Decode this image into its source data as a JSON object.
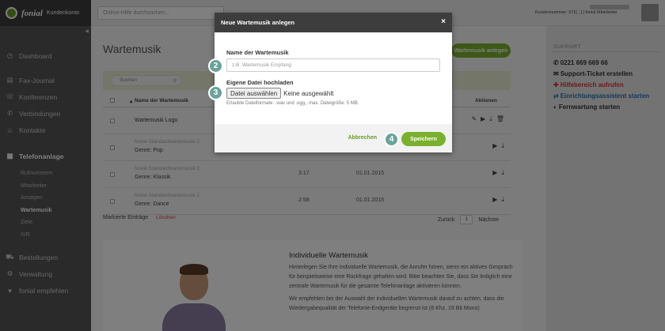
{
  "brand": {
    "name": "fonial",
    "product": "Kundenkonto"
  },
  "topbar": {
    "search_placeholder": "Online-Hilfe durchsuchen...",
    "account_line": "Kundennummer: 371[...] | fonial Mitarbeiter"
  },
  "sidebar": {
    "items": [
      {
        "label": "Dashboard",
        "icon": "dashboard-icon"
      },
      {
        "label": "Fax-Journal",
        "icon": "fax-icon"
      },
      {
        "label": "Konferenzen",
        "icon": "conference-icon"
      },
      {
        "label": "Verbindungen",
        "icon": "connections-icon"
      },
      {
        "label": "Kontakte",
        "icon": "contacts-icon"
      },
      {
        "label": "Telefonanlage",
        "icon": "phone-system-icon"
      }
    ],
    "subitems": [
      "Rufnummern",
      "Mitarbeiter",
      "Ansagen",
      "Wartemusik",
      "Ziele",
      "IVR"
    ],
    "bottom": [
      {
        "label": "Bestellungen",
        "icon": "cart-icon"
      },
      {
        "label": "Verwaltung",
        "icon": "settings-icon"
      },
      {
        "label": "fonial empfehlen",
        "icon": "recommend-icon"
      }
    ]
  },
  "main": {
    "title": "Wartemusik",
    "new_button": "Wartemusik anlegen",
    "search_placeholder": "Suchen",
    "headers": {
      "name": "Name der Wartemusik",
      "actions": "Aktionen"
    },
    "rows": [
      {
        "name": "Wartemusik Logo",
        "sub": "",
        "genre": "",
        "duration": "",
        "date": ""
      },
      {
        "name": "",
        "sub": "fonial Standardwartemusik 2",
        "genre": "Genre: Pop",
        "duration": "",
        "date": ""
      },
      {
        "name": "",
        "sub": "fonial Standardwartemusik 2",
        "genre": "Genre: Klassik",
        "duration": "3:17",
        "date": "01.01.2015"
      },
      {
        "name": "",
        "sub": "fonial Standardwartemusik 2",
        "genre": "Genre: Dance",
        "duration": "2:58",
        "date": "01.01.2015"
      }
    ],
    "footer": {
      "marked": "Markierte Einträge",
      "delete": "Löschen",
      "back": "Zurück",
      "page": "1",
      "next": "Nächste"
    },
    "info": {
      "title": "Individuelle Wartemusik",
      "p1": "Hinterlegen Sie Ihre individuelle Wartemusik, die Anrufer hören, wenn ein aktives Gespräch für beispielsweise eine Rückfrage gehalten wird. Bitte beachten Sie, dass Sie lediglich eine zentrale Wartemusik für die gesamte Telefonanlage aktivieren können.",
      "p2": "Wir empfehlen bei der Auswahl der individuellen Wartemusik darauf zu achten, dass die Wiedergabequalität der Telefonie-Endgeräte begrenzt ist (8 Khz, 16 Bit Mono)"
    }
  },
  "right": {
    "heading": "SUPPORT",
    "items": [
      {
        "label": "0221 669 669 66",
        "icon": "phone-icon"
      },
      {
        "label": "Support-Ticket erstellen",
        "icon": "ticket-icon"
      },
      {
        "label": "Hilfebereich aufrufen",
        "icon": "help-icon"
      },
      {
        "label": "Einrichtungsassistent starten",
        "icon": "wizard-icon"
      },
      {
        "label": "Fernwartung starten",
        "icon": "remote-icon"
      }
    ]
  },
  "modal": {
    "title": "Neue Wartemusik anlegen",
    "close": "×",
    "name_label": "Name der Wartemusik",
    "name_placeholder": "z.B. Wartemusik Empfang",
    "file_label": "Eigene Datei hochladen",
    "file_button": "Datei auswählen",
    "file_status": "Keine ausgewählt",
    "file_hint": "Erlaubte Dateiformate: .wav und .ogg., max. Dateigröße: 5 MB.",
    "cancel": "Abbrechen",
    "save": "Speichern",
    "steps": [
      "2",
      "3",
      "4"
    ]
  },
  "colors": {
    "accent": "#7ab02e",
    "sidebar": "#555555",
    "step": "#6aa39a",
    "link_red": "#dd3333",
    "link_blue": "#2a6fb5"
  }
}
